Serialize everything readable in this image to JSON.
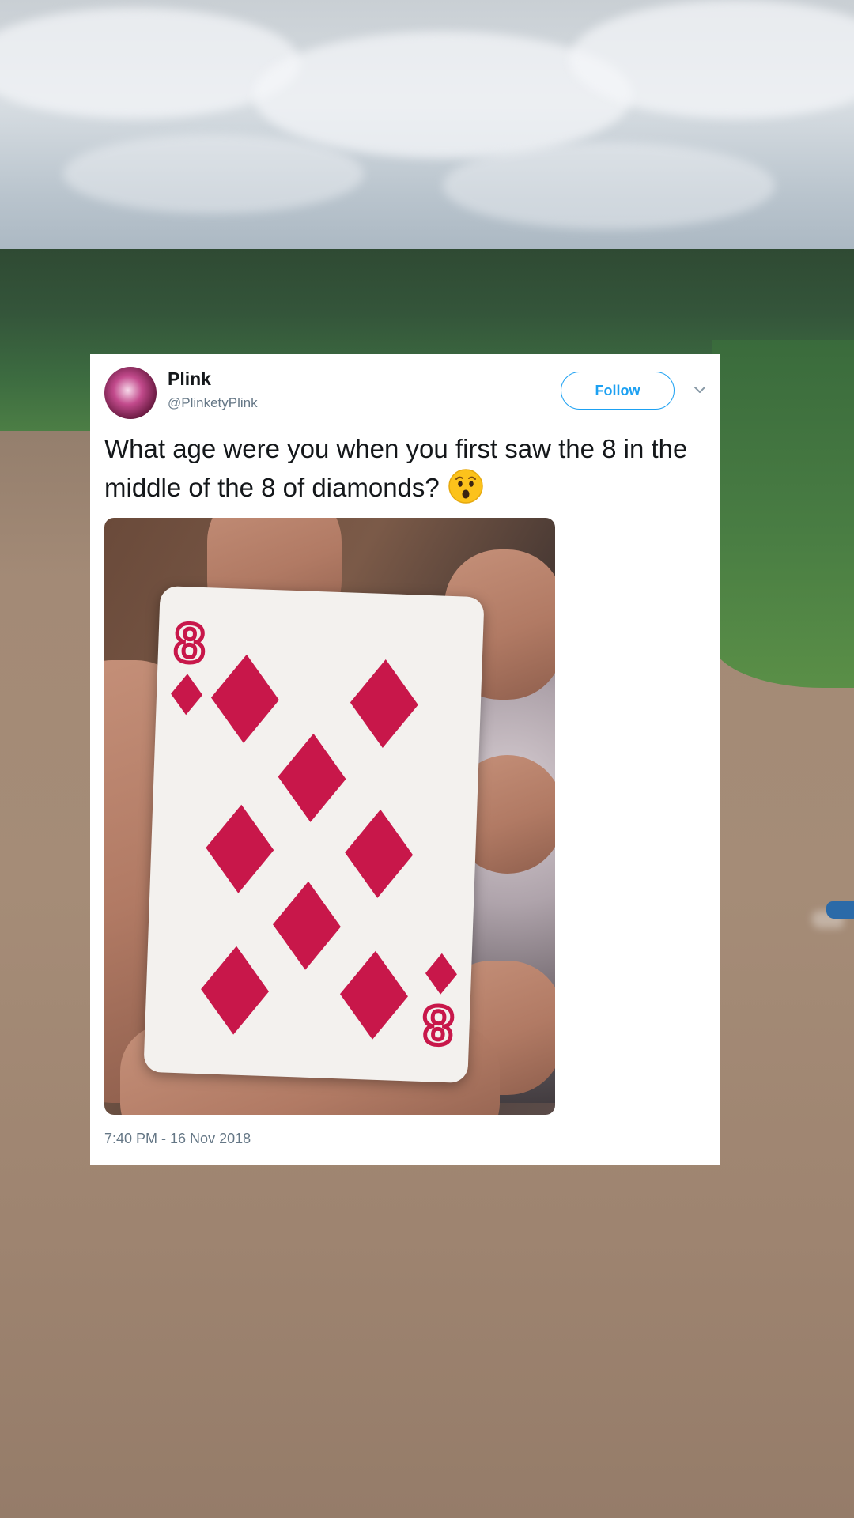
{
  "tweet": {
    "display_name": "Plink",
    "handle": "@PlinketyPlink",
    "follow_label": "Follow",
    "text": "What age were you when you first saw the 8 in the middle of the 8 of diamonds?",
    "emoji": "hushed-face-emoji",
    "timestamp": "7:40 PM - 16 Nov 2018",
    "card": {
      "rank": "8",
      "suit": "diamonds",
      "suit_color": "#c8174a"
    }
  },
  "colors": {
    "accent": "#1da1f2",
    "text_primary": "#14171a",
    "text_secondary": "#657786"
  }
}
